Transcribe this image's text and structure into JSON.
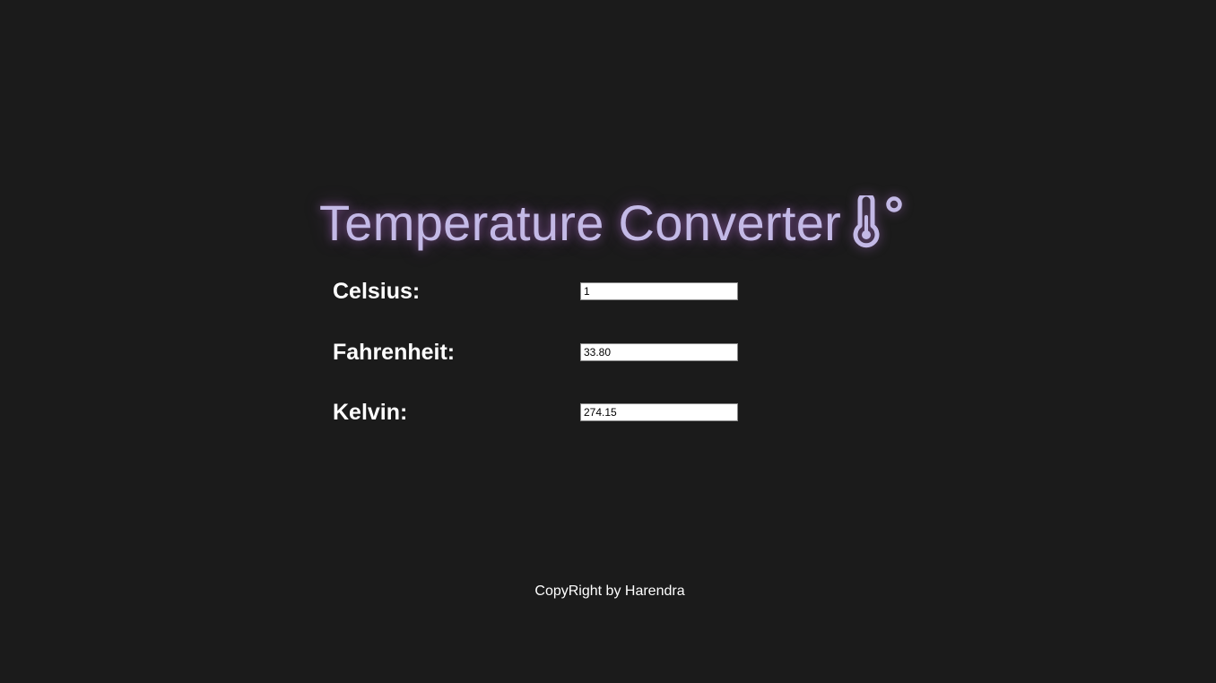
{
  "header": {
    "title": "Temperature Converter",
    "icon": "thermometer-degree-icon",
    "accent_color": "#c3b9e6"
  },
  "fields": {
    "celsius": {
      "label": "Celsius:",
      "value": "1"
    },
    "fahrenheit": {
      "label": "Fahrenheit:",
      "value": "33.80"
    },
    "kelvin": {
      "label": "Kelvin:",
      "value": "274.15"
    }
  },
  "footer": {
    "text": "CopyRight by Harendra"
  },
  "colors": {
    "background": "#1b1b1b",
    "label": "#ffffff"
  }
}
